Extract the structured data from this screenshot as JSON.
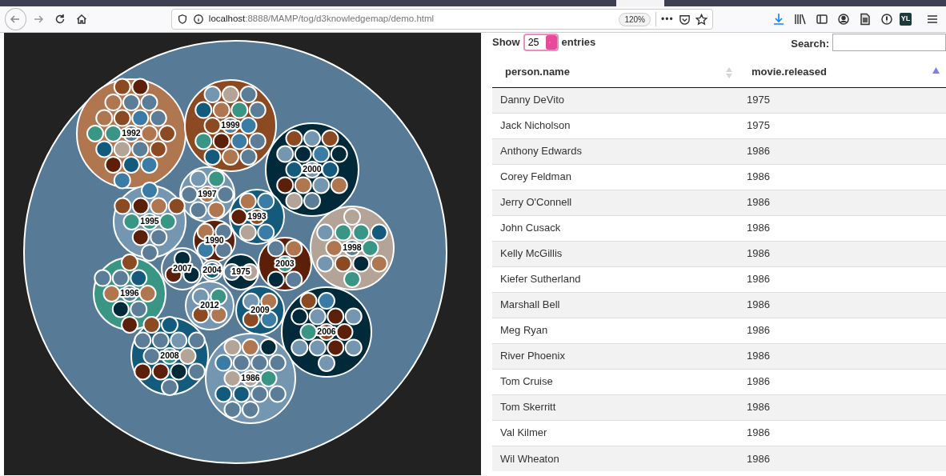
{
  "browser": {
    "url": "**localhost**:8888/MAMP/tog/d3knowledgemap/demo.html",
    "zoom": "120%",
    "menu_dots": "•••",
    "profile_badge": "YL"
  },
  "chart": {
    "groups": [
      {
        "label": "1992",
        "color": "#b07650",
        "members": [
          {
            "color": "#8b4a22"
          },
          {
            "color": "#5c1f0a"
          },
          {
            "color": "#b07650"
          },
          {
            "color": "#5b7d98"
          },
          {
            "color": "#5b7d98"
          },
          {
            "color": "#b07650"
          },
          {
            "color": "#8b4a22"
          },
          {
            "color": "#3a7ca5"
          },
          {
            "color": "#5b7d98"
          },
          {
            "color": "#3a9684"
          },
          {
            "color": "#3a9684"
          },
          {
            "color": "#5b7d98"
          },
          {
            "color": "#b07650"
          },
          {
            "color": "#8b4a22"
          },
          {
            "color": "#135a7c"
          },
          {
            "color": "#b3a497"
          },
          {
            "color": "#5b7d98"
          },
          {
            "color": "#8b4a22"
          },
          {
            "color": "#5c1f0a"
          },
          {
            "color": "#135a7c"
          },
          {
            "color": "#3a7ca5"
          },
          {
            "color": "#3a7ca5"
          }
        ]
      },
      {
        "label": "1999",
        "color": "#8b4a22",
        "members": [
          {
            "color": "#7596b0"
          },
          {
            "color": "#b3a497"
          },
          {
            "color": "#5b7d98"
          },
          {
            "color": "#135a7c"
          },
          {
            "color": "#b07650"
          },
          {
            "color": "#3a9684"
          },
          {
            "color": "#5b7d98"
          },
          {
            "color": "#8b4a22"
          },
          {
            "color": "#5b7d98"
          },
          {
            "color": "#3a7ca5"
          },
          {
            "color": "#3a9684"
          },
          {
            "color": "#5c1f0a"
          },
          {
            "color": "#3a7ca5"
          },
          {
            "color": "#5b7d98"
          },
          {
            "color": "#135a7c"
          },
          {
            "color": "#b07650"
          },
          {
            "color": "#5b7d98"
          }
        ]
      },
      {
        "label": "2000",
        "color": "#002a3a",
        "members": [
          {
            "color": "#8b4a22"
          },
          {
            "color": "#7596b0"
          },
          {
            "color": "#8b4a22"
          },
          {
            "color": "#7596b0"
          },
          {
            "color": "#002a3a"
          },
          {
            "color": "#3a7ca5"
          },
          {
            "color": "#002a3a"
          },
          {
            "color": "#135a7c"
          },
          {
            "color": "#7596b0"
          },
          {
            "color": "#135a7c"
          },
          {
            "color": "#5c1f0a"
          },
          {
            "color": "#b07650"
          },
          {
            "color": "#7596b0"
          },
          {
            "color": "#b07650"
          },
          {
            "color": "#b3a497"
          },
          {
            "color": "#5b7d98"
          }
        ]
      },
      {
        "label": "1997",
        "color": "#7596b0",
        "members": [
          {
            "color": "#7596b0"
          },
          {
            "color": "#3a9684"
          },
          {
            "color": "#5b7d98"
          },
          {
            "color": "#b07650"
          },
          {
            "color": "#5b7d98"
          },
          {
            "color": "#5b7d98"
          },
          {
            "color": "#b07650"
          }
        ]
      },
      {
        "label": "1995",
        "color": "#7596b0",
        "members": [
          {
            "color": "#3a7ca5"
          },
          {
            "color": "#8b4a22"
          },
          {
            "color": "#5c1f0a"
          },
          {
            "color": "#b07650"
          },
          {
            "color": "#8b4a22"
          },
          {
            "color": "#3a9684"
          },
          {
            "color": "#3a9684"
          },
          {
            "color": "#3a9684"
          },
          {
            "color": "#5c1f0a"
          },
          {
            "color": "#5b7d98"
          },
          {
            "color": "#5b7d98"
          }
        ]
      },
      {
        "label": "1993",
        "color": "#135a7c",
        "members": [
          {
            "color": "#b07650"
          },
          {
            "color": "#3a7ca5"
          },
          {
            "color": "#5c1f0a"
          },
          {
            "color": "#8b4a22"
          },
          {
            "color": "#b3a497"
          },
          {
            "color": "#3a7ca5"
          }
        ]
      },
      {
        "label": "1998",
        "color": "#b3a497",
        "members": [
          {
            "color": "#b3a497"
          },
          {
            "color": "#7596b0"
          },
          {
            "color": "#3a9684"
          },
          {
            "color": "#3a9684"
          },
          {
            "color": "#135a7c"
          },
          {
            "color": "#b07650"
          },
          {
            "color": "#5b7d98"
          },
          {
            "color": "#3a9684"
          },
          {
            "color": "#7596b0"
          },
          {
            "color": "#8b4a22"
          },
          {
            "color": "#002a3a"
          },
          {
            "color": "#b07650"
          },
          {
            "color": "#3a9684"
          }
        ]
      },
      {
        "label": "1990",
        "color": "#5c1f0a",
        "members": [
          {
            "color": "#b07650"
          },
          {
            "color": "#5b7d98"
          },
          {
            "color": "#3a7ca5"
          },
          {
            "color": "#5b7d98"
          }
        ]
      },
      {
        "label": "2007",
        "color": "#5b7d98",
        "members": [
          {
            "color": "#002a3a"
          },
          {
            "color": "#5c1f0a"
          },
          {
            "color": "#002a3a"
          }
        ]
      },
      {
        "label": "2004",
        "color": "#5b7d98",
        "members": [
          {
            "color": "#135a7c"
          }
        ]
      },
      {
        "label": "1975",
        "color": "#002a3a",
        "members": [
          {
            "color": "#5b7d98"
          },
          {
            "color": "#b3a497"
          }
        ]
      },
      {
        "label": "2003",
        "color": "#5c1f0a",
        "members": [
          {
            "color": "#5b7d98"
          },
          {
            "color": "#b07650"
          },
          {
            "color": "#3a9684"
          },
          {
            "color": "#002a3a"
          },
          {
            "color": "#5b7d98"
          }
        ]
      },
      {
        "label": "1996",
        "color": "#3a9684",
        "members": [
          {
            "color": "#8b4a22"
          },
          {
            "color": "#5b7d98"
          },
          {
            "color": "#5b7d98"
          },
          {
            "color": "#135a7c"
          },
          {
            "color": "#b07650"
          },
          {
            "color": "#5b7d98"
          },
          {
            "color": "#b07650"
          },
          {
            "color": "#002a3a"
          },
          {
            "color": "#5b7d98"
          },
          {
            "color": "#5c1f0a"
          }
        ]
      },
      {
        "label": "2012",
        "color": "#7596b0",
        "members": [
          {
            "color": "#7596b0"
          },
          {
            "color": "#3a9684"
          },
          {
            "color": "#8b4a22"
          },
          {
            "color": "#b07650"
          }
        ]
      },
      {
        "label": "2009",
        "color": "#135a7c",
        "members": [
          {
            "color": "#7596b0"
          },
          {
            "color": "#b07650"
          },
          {
            "color": "#8b4a22"
          },
          {
            "color": "#3a7ca5"
          }
        ]
      },
      {
        "label": "2006",
        "color": "#002a3a",
        "members": [
          {
            "color": "#8b4a22"
          },
          {
            "color": "#3a7ca5"
          },
          {
            "color": "#002a3a"
          },
          {
            "color": "#7596b0"
          },
          {
            "color": "#5c1f0a"
          },
          {
            "color": "#7596b0"
          },
          {
            "color": "#3a9684"
          },
          {
            "color": "#8b4a22"
          },
          {
            "color": "#5c1f0a"
          },
          {
            "color": "#7596b0"
          },
          {
            "color": "#7596b0"
          },
          {
            "color": "#5c1f0a"
          },
          {
            "color": "#7596b0"
          },
          {
            "color": "#7596b0"
          }
        ]
      },
      {
        "label": "2008",
        "color": "#135a7c",
        "members": [
          {
            "color": "#8b4a22"
          },
          {
            "color": "#135a7c"
          },
          {
            "color": "#5b7d98"
          },
          {
            "color": "#5b7d98"
          },
          {
            "color": "#7596b0"
          },
          {
            "color": "#5b7d98"
          },
          {
            "color": "#5b7d98"
          },
          {
            "color": "#3a9684"
          },
          {
            "color": "#b3a497"
          },
          {
            "color": "#5c1f0a"
          },
          {
            "color": "#5c1f0a"
          },
          {
            "color": "#002a3a"
          },
          {
            "color": "#5b7d98"
          },
          {
            "color": "#5b7d98"
          }
        ]
      },
      {
        "label": "1986",
        "color": "#7596b0",
        "members": [
          {
            "color": "#b3a497"
          },
          {
            "color": "#b07650"
          },
          {
            "color": "#002a3a"
          },
          {
            "color": "#3a7ca5"
          },
          {
            "color": "#5b7d98"
          },
          {
            "color": "#5b7d98"
          },
          {
            "color": "#5b7d98"
          },
          {
            "color": "#b3a497"
          },
          {
            "color": "#b3a497"
          },
          {
            "color": "#3a9684"
          },
          {
            "color": "#135a7c"
          },
          {
            "color": "#135a7c"
          },
          {
            "color": "#5b7d98"
          },
          {
            "color": "#5b7d98"
          },
          {
            "color": "#5b7d98"
          },
          {
            "color": "#5b7d98"
          }
        ]
      }
    ]
  },
  "table": {
    "show_label": "Show",
    "length_value": "25",
    "entries_label": "entries",
    "search_label": "Search:",
    "columns": [
      {
        "label": "person.name",
        "sorted": false
      },
      {
        "label": "movie.released",
        "sorted": true
      }
    ],
    "rows": [
      [
        "Danny DeVito",
        "1975"
      ],
      [
        "Jack Nicholson",
        "1975"
      ],
      [
        "Anthony Edwards",
        "1986"
      ],
      [
        "Corey Feldman",
        "1986"
      ],
      [
        "Jerry O'Connell",
        "1986"
      ],
      [
        "John Cusack",
        "1986"
      ],
      [
        "Kelly McGillis",
        "1986"
      ],
      [
        "Kiefer Sutherland",
        "1986"
      ],
      [
        "Marshall Bell",
        "1986"
      ],
      [
        "Meg Ryan",
        "1986"
      ],
      [
        "River Phoenix",
        "1986"
      ],
      [
        "Tom Cruise",
        "1986"
      ],
      [
        "Tom Skerritt",
        "1986"
      ],
      [
        "Val Kilmer",
        "1986"
      ],
      [
        "Wil Wheaton",
        "1986"
      ]
    ]
  }
}
